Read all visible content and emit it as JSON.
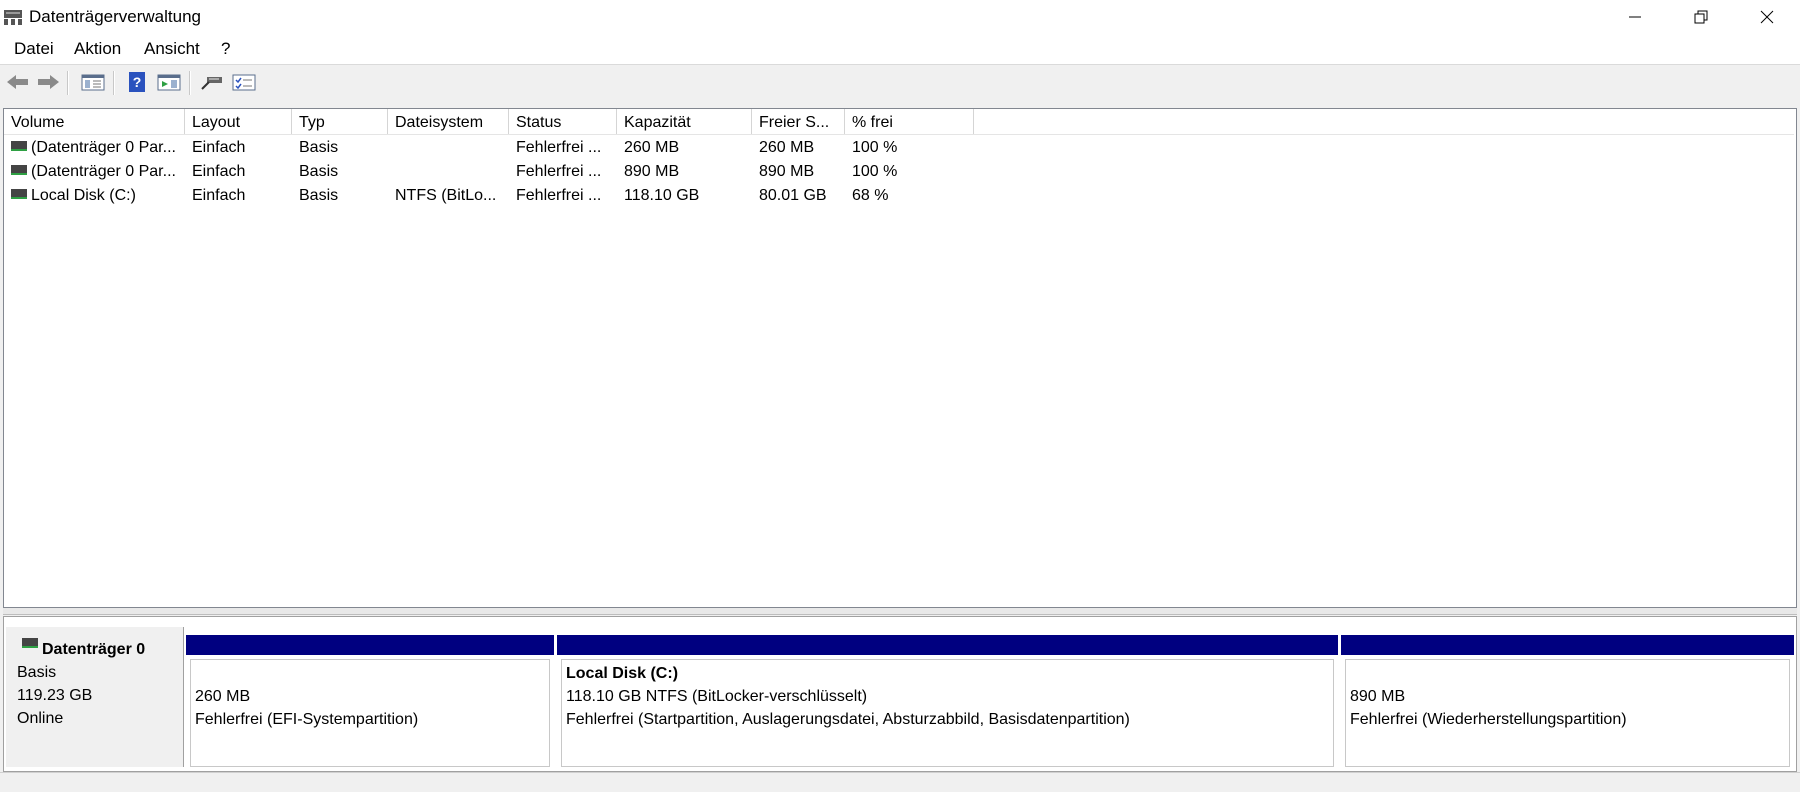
{
  "window": {
    "title": "Datenträgerverwaltung",
    "icon": "disk-management-icon"
  },
  "menu": {
    "items": [
      {
        "label": "Datei"
      },
      {
        "label": "Aktion"
      },
      {
        "label": "Ansicht"
      },
      {
        "label": "?"
      }
    ]
  },
  "toolbar": {
    "icons": [
      "back-arrow-icon",
      "forward-arrow-icon",
      "console-tree-icon",
      "help-icon",
      "action-pane-icon",
      "connect-disk-icon",
      "properties-icon"
    ]
  },
  "volume_list": {
    "columns": [
      "Volume",
      "Layout",
      "Typ",
      "Dateisystem",
      "Status",
      "Kapazität",
      "Freier S...",
      "% frei"
    ],
    "rows": [
      {
        "volume": "(Datenträger 0 Par...",
        "layout": "Einfach",
        "typ": "Basis",
        "dateisystem": "",
        "status": "Fehlerfrei ...",
        "kapazitaet": "260 MB",
        "frei": "260 MB",
        "prozent": "100 %"
      },
      {
        "volume": "(Datenträger 0 Par...",
        "layout": "Einfach",
        "typ": "Basis",
        "dateisystem": "",
        "status": "Fehlerfrei ...",
        "kapazitaet": "890 MB",
        "frei": "890 MB",
        "prozent": "100 %"
      },
      {
        "volume": "Local Disk (C:)",
        "layout": "Einfach",
        "typ": "Basis",
        "dateisystem": "NTFS (BitLo...",
        "status": "Fehlerfrei ...",
        "kapazitaet": "118.10 GB",
        "frei": "80.01 GB",
        "prozent": "68 %"
      }
    ]
  },
  "disk": {
    "name": "Datenträger 0",
    "type": "Basis",
    "size": "119.23 GB",
    "state": "Online",
    "partitions": [
      {
        "title": "",
        "size": "260 MB",
        "status": "Fehlerfrei (EFI-Systempartition)"
      },
      {
        "title": "Local Disk  (C:)",
        "size": "118.10 GB NTFS (BitLocker-verschlüsselt)",
        "status": "Fehlerfrei (Startpartition, Auslagerungsdatei, Absturzabbild, Basisdatenpartition)"
      },
      {
        "title": "",
        "size": "890 MB",
        "status": "Fehlerfrei (Wiederherstellungspartition)"
      }
    ],
    "partition_color": "#000080"
  }
}
